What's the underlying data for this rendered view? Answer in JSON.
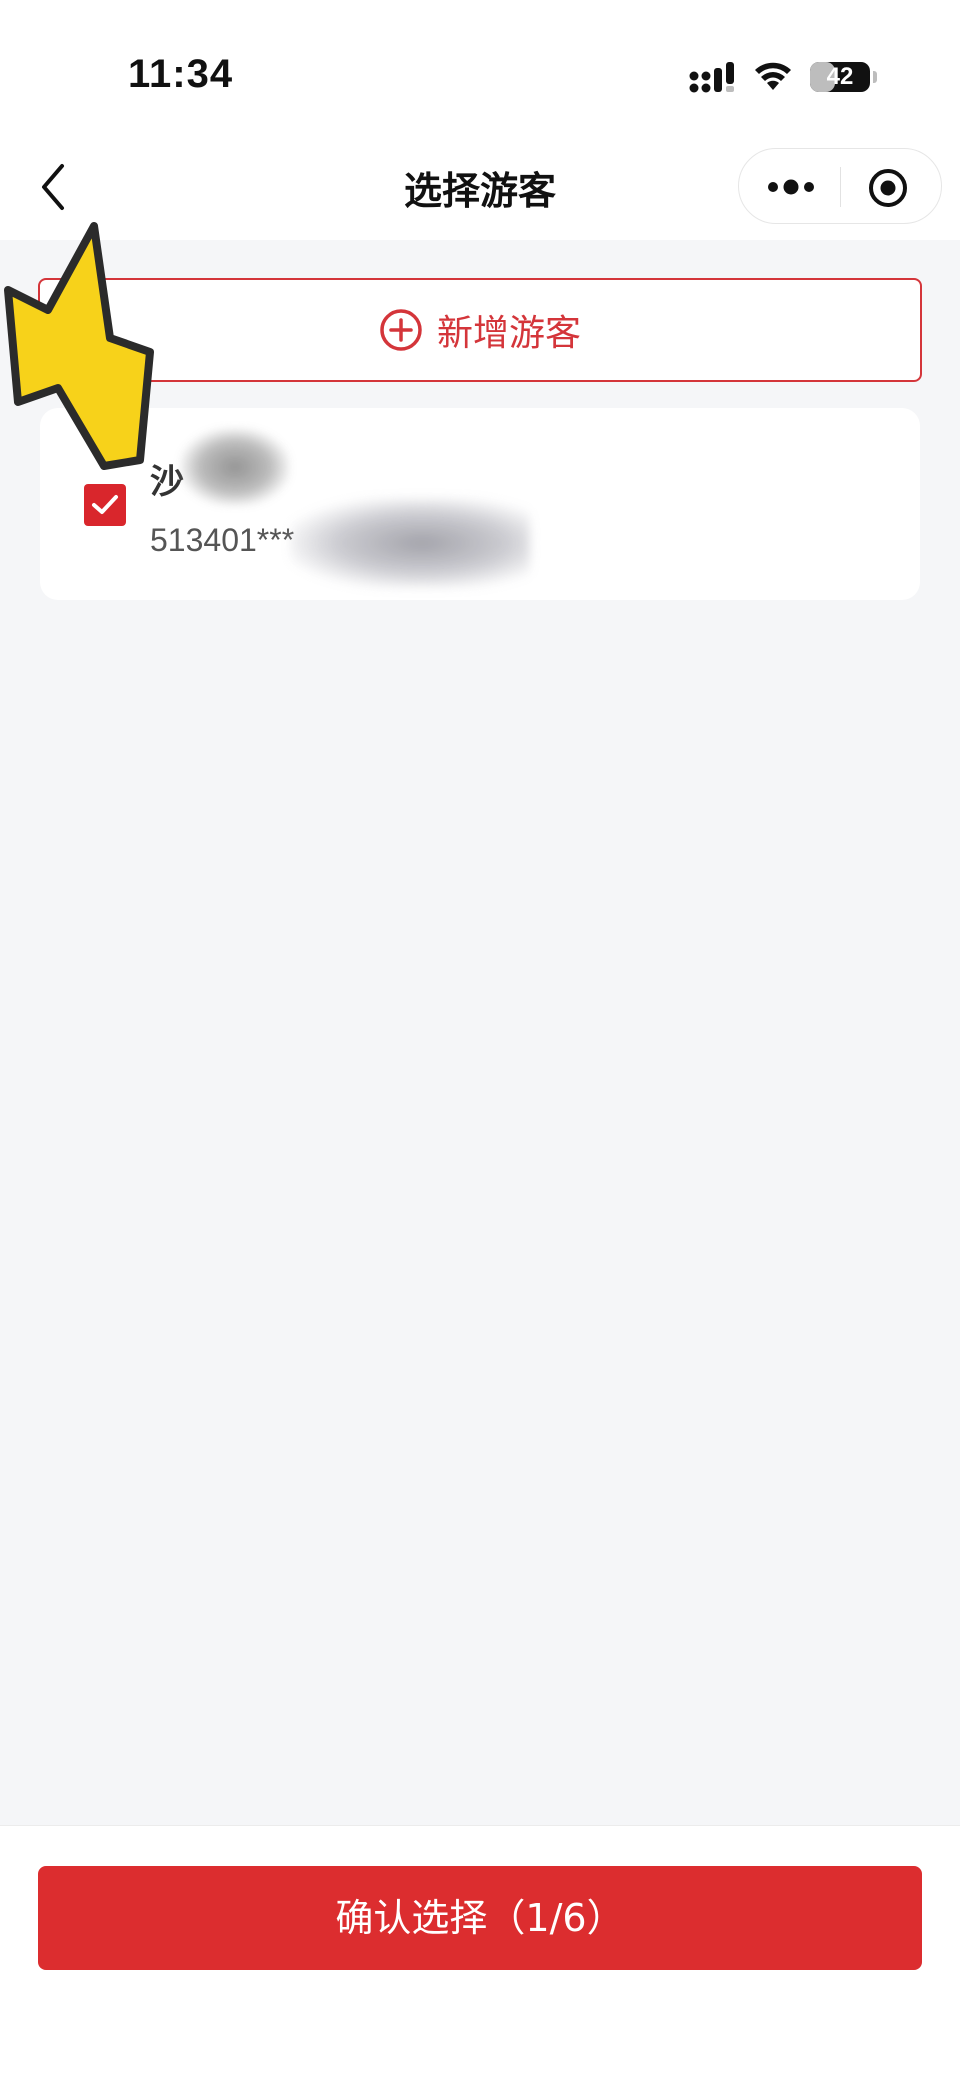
{
  "status_bar": {
    "time": "11:34",
    "battery_level": "42",
    "battery_fraction": 0.42
  },
  "nav": {
    "title": "选择游客",
    "back_icon": "chevron-left-icon",
    "more_icon": "more-dots-icon",
    "close_icon": "target-circle-icon"
  },
  "add_visitor": {
    "label": "新增游客",
    "icon": "plus-circle-icon"
  },
  "visitors": [
    {
      "name": "沙",
      "id_number": "513401***",
      "checked": true
    }
  ],
  "confirm": {
    "label": "确认选择（1/6）"
  },
  "colors": {
    "accent": "#dc2d2f",
    "background": "#f5f6f8",
    "annotation_arrow": "#f7d21a"
  }
}
